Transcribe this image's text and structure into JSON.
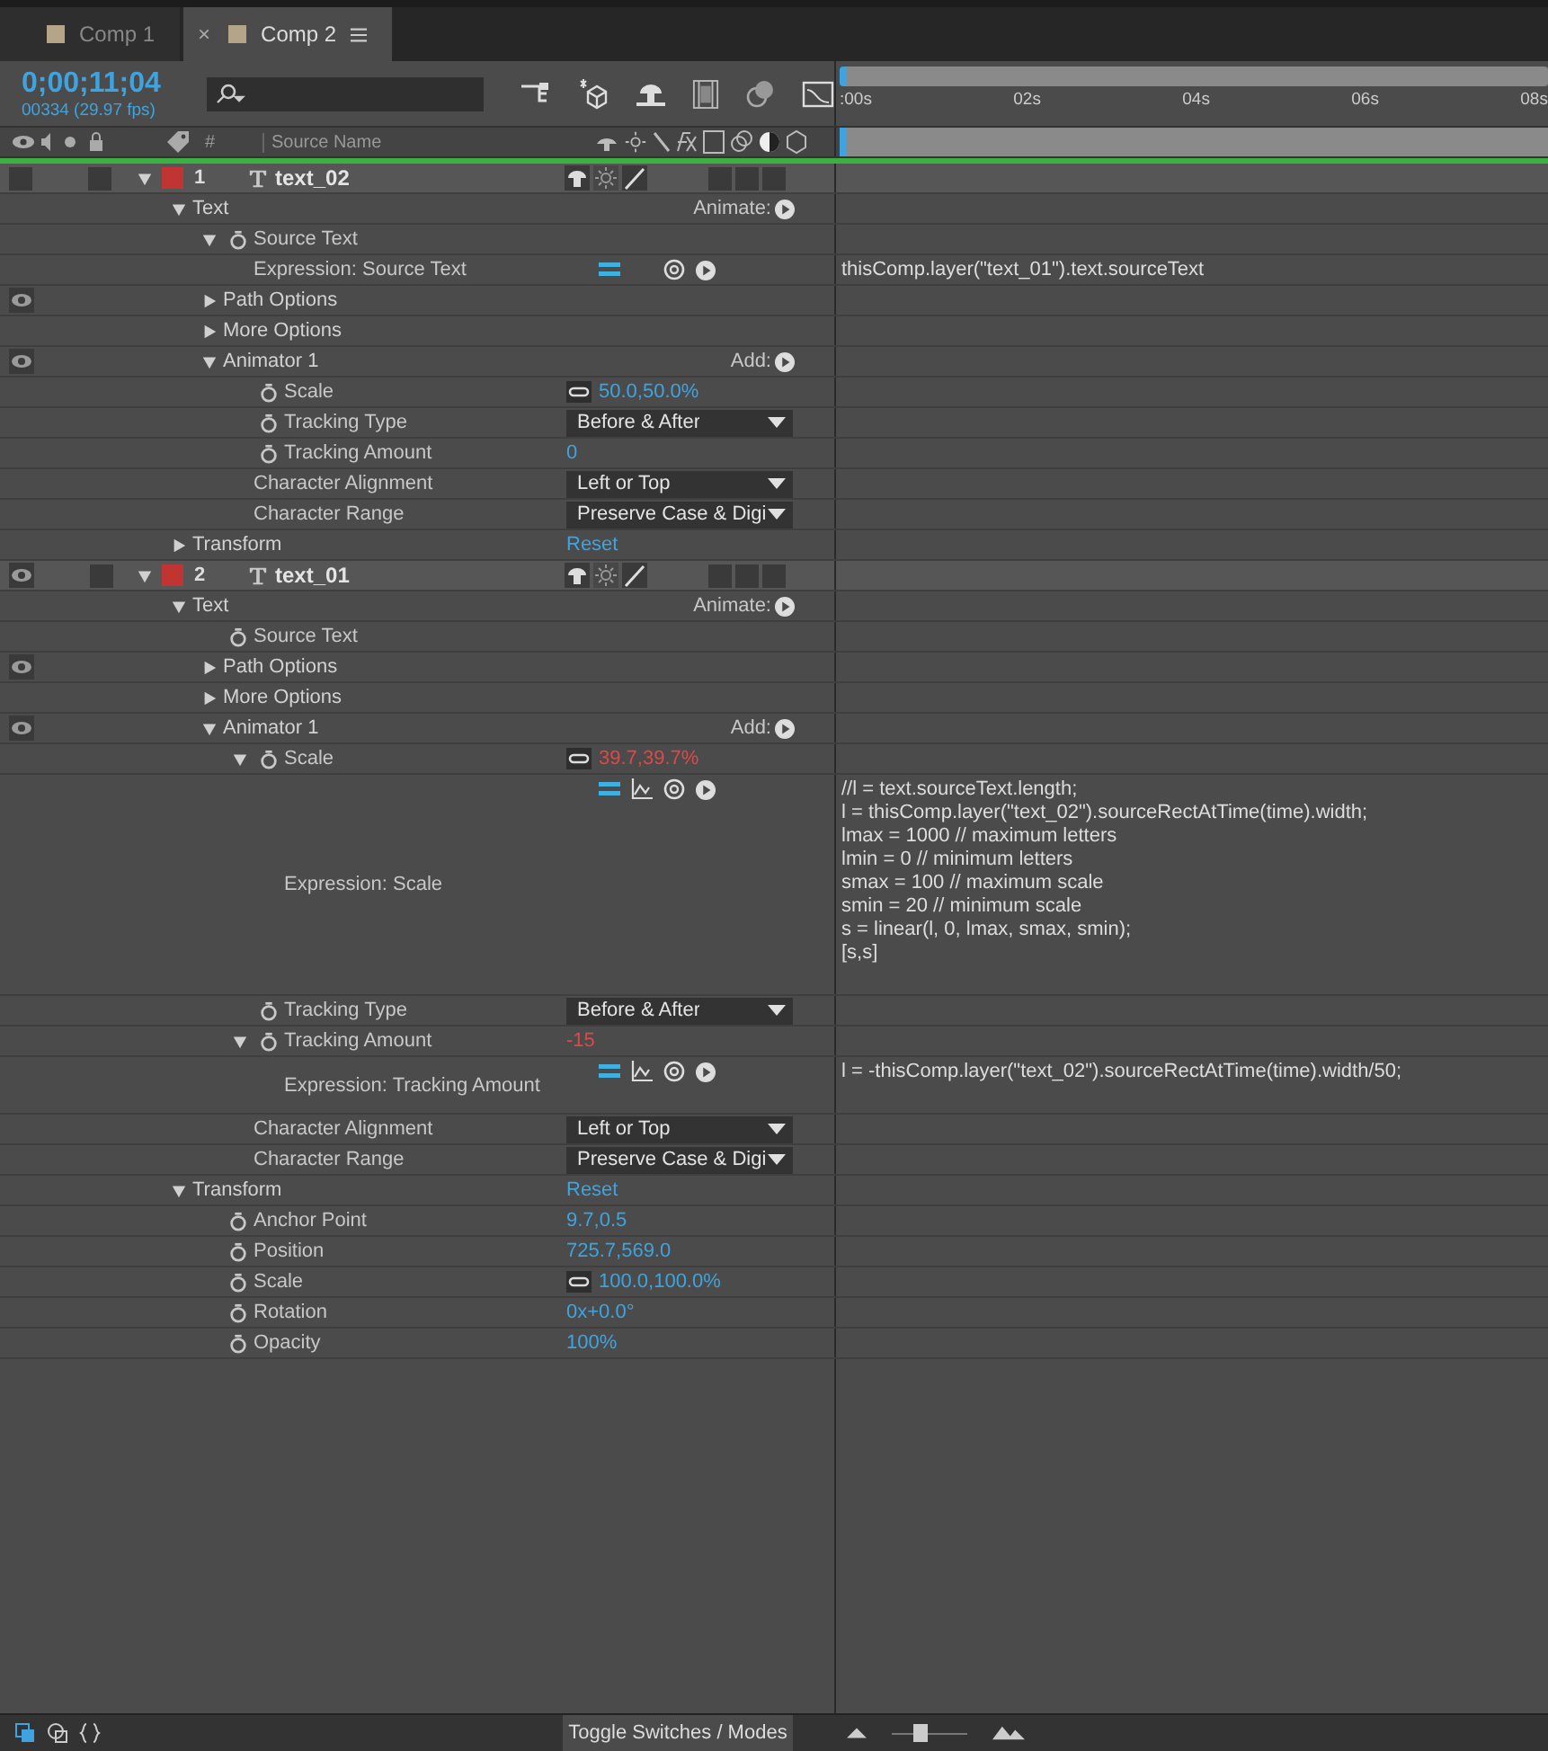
{
  "tabs": [
    {
      "label": "Comp 1",
      "selected": false
    },
    {
      "label": "Comp 2",
      "selected": true,
      "close": "×"
    }
  ],
  "time": {
    "timecode": "0;00;11;04",
    "frames": "00334 (29.97 fps)"
  },
  "columns": [
    "#",
    "Source Name"
  ],
  "ruler": [
    ":00s",
    "02s",
    "04s",
    "06s",
    "08s"
  ],
  "layers": [
    {
      "kind": "layer",
      "number": "1",
      "name": "text_02",
      "color": "#c03434",
      "visible": false,
      "locked": false,
      "expanded": true,
      "children": [
        {
          "kind": "group",
          "label": "Text",
          "expanded": true,
          "action": "Animate:",
          "children": [
            {
              "kind": "property",
              "label": "Source Text",
              "stopwatch": true,
              "expanded": true,
              "children": [
                {
                  "kind": "expression",
                  "label": "Expression: Source Text",
                  "graph": false,
                  "code": [
                    "thisComp.layer(\"text_01\").text.sourceText"
                  ]
                }
              ]
            },
            {
              "kind": "group",
              "label": "Path Options",
              "expanded": false,
              "visible": true
            },
            {
              "kind": "group",
              "label": "More Options",
              "expanded": false
            },
            {
              "kind": "group",
              "label": "Animator 1",
              "expanded": true,
              "visible": true,
              "action": "Add:",
              "children": [
                {
                  "kind": "property",
                  "label": "Scale",
                  "stopwatch": true,
                  "linked": true,
                  "value": "50.0,50.0%"
                },
                {
                  "kind": "property",
                  "label": "Tracking Type",
                  "stopwatch": true,
                  "dropdown": "Before & After"
                },
                {
                  "kind": "property",
                  "label": "Tracking Amount",
                  "stopwatch": true,
                  "value": "0"
                },
                {
                  "kind": "property",
                  "label": "Character Alignment",
                  "dropdown": "Left or Top"
                },
                {
                  "kind": "property",
                  "label": "Character Range",
                  "dropdown": "Preserve Case & Digi"
                }
              ]
            }
          ]
        },
        {
          "kind": "group",
          "label": "Transform",
          "expanded": false,
          "link": "Reset"
        }
      ]
    },
    {
      "kind": "layer",
      "number": "2",
      "name": "text_01",
      "color": "#c03434",
      "visible": true,
      "locked": false,
      "expanded": true,
      "children": [
        {
          "kind": "group",
          "label": "Text",
          "expanded": true,
          "action": "Animate:",
          "children": [
            {
              "kind": "property",
              "label": "Source Text",
              "stopwatch": true
            },
            {
              "kind": "group",
              "label": "Path Options",
              "expanded": false,
              "visible": true
            },
            {
              "kind": "group",
              "label": "More Options",
              "expanded": false
            },
            {
              "kind": "group",
              "label": "Animator 1",
              "expanded": true,
              "visible": true,
              "action": "Add:",
              "children": [
                {
                  "kind": "property",
                  "label": "Scale",
                  "stopwatch": true,
                  "expanded": true,
                  "linked": true,
                  "value": "39.7,39.7%",
                  "driven": true,
                  "children": [
                    {
                      "kind": "expression",
                      "label": "Expression: Scale",
                      "graph": true,
                      "code": [
                        "//l = text.sourceText.length;",
                        "l = thisComp.layer(\"text_02\").sourceRectAtTime(time).width;",
                        "lmax = 1000 // maximum letters",
                        "lmin = 0 // minimum letters",
                        "smax = 100 // maximum scale",
                        "smin = 20 // minimum scale",
                        "s = linear(l, 0, lmax, smax, smin);",
                        "[s,s]"
                      ]
                    }
                  ]
                },
                {
                  "kind": "property",
                  "label": "Tracking Type",
                  "stopwatch": true,
                  "dropdown": "Before & After"
                },
                {
                  "kind": "property",
                  "label": "Tracking Amount",
                  "stopwatch": true,
                  "expanded": true,
                  "value": "-15",
                  "driven": true,
                  "children": [
                    {
                      "kind": "expression",
                      "label": "Expression: Tracking Amount",
                      "graph": true,
                      "code": [
                        "l = -thisComp.layer(\"text_02\").sourceRectAtTime(time).width/50;"
                      ]
                    }
                  ]
                },
                {
                  "kind": "property",
                  "label": "Character Alignment",
                  "dropdown": "Left or Top"
                },
                {
                  "kind": "property",
                  "label": "Character Range",
                  "dropdown": "Preserve Case & Digi"
                }
              ]
            }
          ]
        },
        {
          "kind": "group",
          "label": "Transform",
          "expanded": true,
          "link": "Reset",
          "children": [
            {
              "kind": "property",
              "label": "Anchor Point",
              "stopwatch": true,
              "value": "9.7,0.5"
            },
            {
              "kind": "property",
              "label": "Position",
              "stopwatch": true,
              "value": "725.7,569.0"
            },
            {
              "kind": "property",
              "label": "Scale",
              "stopwatch": true,
              "linked": true,
              "value": "100.0,100.0%"
            },
            {
              "kind": "property",
              "label": "Rotation",
              "stopwatch": true,
              "value": "0x+0.0°"
            },
            {
              "kind": "property",
              "label": "Opacity",
              "stopwatch": true,
              "value": "100%"
            }
          ]
        }
      ]
    }
  ],
  "footer": {
    "toggle": "Toggle Switches / Modes",
    "zoom": {
      "level": 0.35
    }
  }
}
